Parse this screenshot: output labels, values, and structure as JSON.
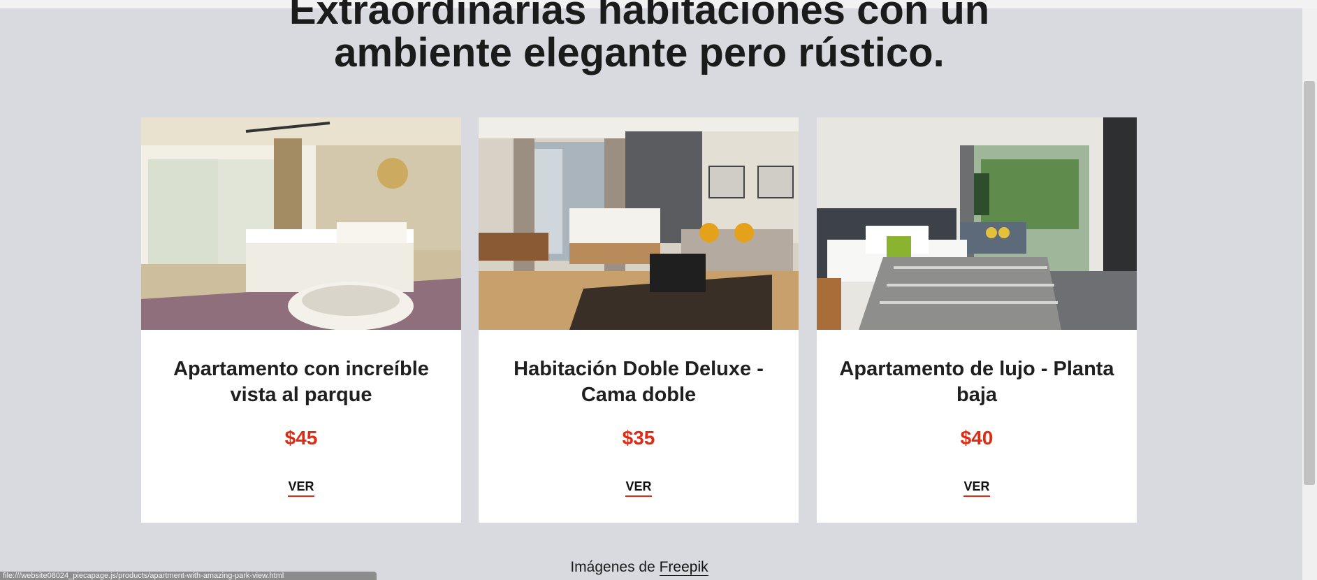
{
  "heading": {
    "line1": "Extraordinarias habitaciones con un",
    "line2": "ambiente elegante pero rústico."
  },
  "rooms": [
    {
      "title": "Apartamento con increíble vista al parque",
      "price": "$45",
      "cta": "VER"
    },
    {
      "title": "Habitación Doble Deluxe - Cama doble",
      "price": "$35",
      "cta": "VER"
    },
    {
      "title": "Apartamento de lujo - Planta baja",
      "price": "$40",
      "cta": "VER"
    }
  ],
  "credit": {
    "prefix": "Imágenes de",
    "link": "Freepik"
  },
  "status_url": "file:///website08024_piecapage.js/products/apartment-with-amazing-park-view.html",
  "colors": {
    "accent": "#e02a12",
    "background": "#d9dae0",
    "card": "#ffffff"
  }
}
